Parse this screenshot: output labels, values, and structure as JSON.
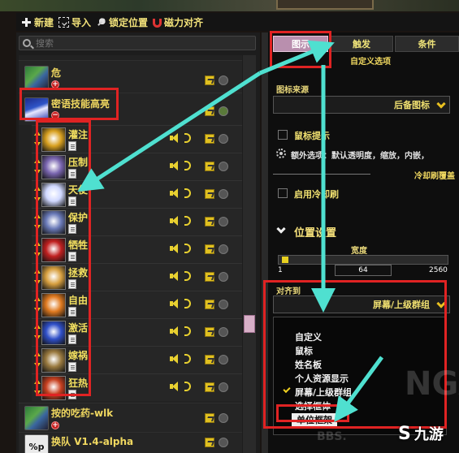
{
  "toolbar": {
    "new_label": "新建",
    "import_label": "导入",
    "lock_label": "锁定位置",
    "magnet_label": "磁力对齐"
  },
  "search": {
    "placeholder": "搜索"
  },
  "groups": [
    {
      "name": "危"
    },
    {
      "name": "密语技能高亮"
    },
    {
      "name": "按的吃药-wlk"
    },
    {
      "name": "换队 V1.4-alpha",
      "icon_text": "%p"
    }
  ],
  "auras": [
    {
      "name": "灌注",
      "color": "#d8a020"
    },
    {
      "name": "压制",
      "color": "#7a66b0"
    },
    {
      "name": "天使",
      "color": "#d0d8ff"
    },
    {
      "name": "保护",
      "color": "#6a7ab8"
    },
    {
      "name": "牺牲",
      "color": "#c02020"
    },
    {
      "name": "拯救",
      "color": "#d8a040"
    },
    {
      "name": "自由",
      "color": "#e07a20"
    },
    {
      "name": "激活",
      "color": "#3050c8"
    },
    {
      "name": "嫁祸",
      "color": "#9a7a40"
    },
    {
      "name": "狂热",
      "color": "#c84020"
    }
  ],
  "tabs": [
    {
      "label": "图示"
    },
    {
      "label": "触发"
    },
    {
      "label": "条件"
    }
  ],
  "right": {
    "custom_options": "自定义选项",
    "icon_source_label": "图标来源",
    "icon_source_value": "后备图标",
    "mouse_tooltip": "鼠标提示",
    "extra_options": "额外选项：默认透明度，缩放，内嵌，",
    "cooldown_header": "冷却刷覆盖",
    "enable_cooldown": "启用冷却刷",
    "position_settings": "位置设置",
    "width_label": "宽度",
    "width_min": "1",
    "width_value": "64",
    "width_max": "2560",
    "anchor_label": "对齐到",
    "anchor_value": "屏幕/上级群组"
  },
  "anchor_menu": [
    {
      "label": "自定义",
      "checked": false
    },
    {
      "label": "鼠标",
      "checked": false
    },
    {
      "label": "姓名板",
      "checked": false
    },
    {
      "label": "个人资源显示",
      "checked": false
    },
    {
      "label": "屏幕/上级群组",
      "checked": true
    },
    {
      "label": "选择框体",
      "checked": false
    },
    {
      "label": "单位框架",
      "checked": false,
      "highlighted": true
    }
  ],
  "watermark": {
    "site": "BBS.",
    "brand": "九游",
    "ngа": "NGA"
  },
  "colors": {
    "accent_red": "#e02323",
    "arrow_cyan": "#4fe0d0",
    "tab_active": "#b98fae"
  }
}
